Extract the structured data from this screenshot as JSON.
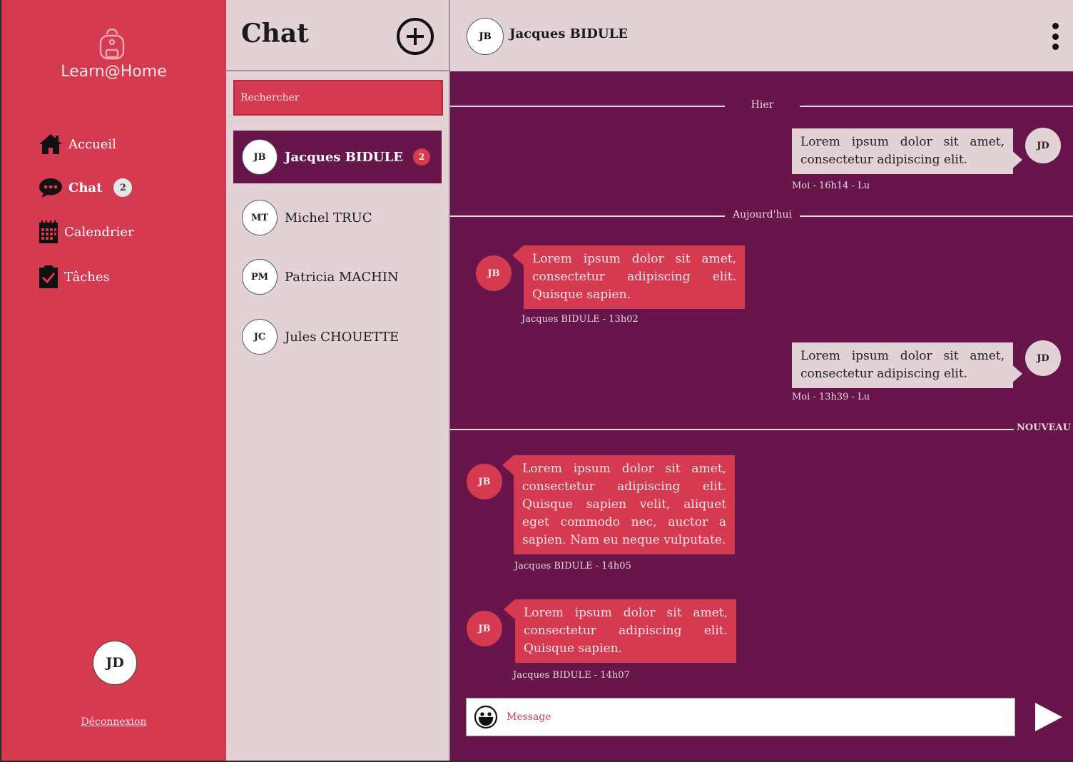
{
  "app": {
    "name": "Learn@Home"
  },
  "nav": {
    "items": [
      {
        "label": "Accueil",
        "icon": "home-icon"
      },
      {
        "label": "Chat",
        "icon": "chat-bubble-icon",
        "badge": "2"
      },
      {
        "label": "Calendrier",
        "icon": "calendar-icon"
      },
      {
        "label": "Tâches",
        "icon": "clipboard-check-icon"
      }
    ]
  },
  "user": {
    "initials": "JD",
    "logout_label": "Déconnexion"
  },
  "conversations": {
    "title": "Chat",
    "search_placeholder": "Rechercher",
    "items": [
      {
        "initials": "JB",
        "name": "Jacques BIDULE",
        "badge": "2"
      },
      {
        "initials": "MT",
        "name": "Michel TRUC"
      },
      {
        "initials": "PM",
        "name": "Patricia MACHIN"
      },
      {
        "initials": "JC",
        "name": "Jules CHOUETTE"
      }
    ]
  },
  "chat": {
    "contact": {
      "initials": "JB",
      "name": "Jacques BIDULE"
    },
    "dividers": [
      "Hier",
      "Aujourd'hui",
      "NOUVEAU"
    ],
    "messages": [
      {
        "from": "me",
        "initials": "JD",
        "text": "Lorem ipsum dolor sit amet, consectetur adipiscing elit.",
        "meta": "Moi - 16h14 - Lu"
      },
      {
        "from": "them",
        "initials": "JB",
        "text": "Lorem ipsum dolor sit amet, consectetur adipiscing elit. Quisque sapien.",
        "meta": "Jacques BIDULE - 13h02"
      },
      {
        "from": "me",
        "initials": "JD",
        "text": "Lorem ipsum dolor sit amet, consectetur adipiscing elit.",
        "meta": "Moi - 13h39 - Lu"
      },
      {
        "from": "them",
        "initials": "JB",
        "text": "Lorem ipsum dolor sit amet, consectetur adipiscing elit. Quisque sapien velit, aliquet eget commodo nec, auctor a sapien. Nam eu neque vulputate.",
        "meta": "Jacques BIDULE - 14h05"
      },
      {
        "from": "them",
        "initials": "JB",
        "text": "Lorem ipsum dolor sit amet, consectetur adipiscing elit. Quisque sapien.",
        "meta": "Jacques BIDULE - 14h07"
      }
    ],
    "composer_placeholder": "Message"
  },
  "colors": {
    "primary": "#d63a50",
    "dark": "#67154a",
    "light": "#e2d1d5"
  }
}
